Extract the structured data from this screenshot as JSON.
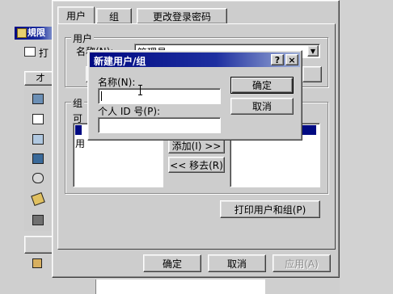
{
  "background_window": {
    "title_fragment": "規限",
    "toolbar_label": "打",
    "column_header": "才"
  },
  "main_dialog": {
    "tabs": [
      {
        "label": "用户",
        "active": true
      },
      {
        "label": "组",
        "active": false
      },
      {
        "label": "更改登录密码",
        "active": false
      }
    ],
    "user_group_title": "用户",
    "name_label": "名称(N):",
    "name_value": "管理員",
    "group_title_fragment": "组",
    "available_label": "可",
    "list_items": [
      "用"
    ],
    "add_button": "添加(I) >>",
    "remove_button": "<< 移去(R)",
    "print_button": "打印用户和组(P)",
    "ok_button": "确定",
    "cancel_button": "取消",
    "apply_button": "应用(A)"
  },
  "new_dialog": {
    "title": "新建用户/组",
    "help_label": "?",
    "close_label": "×",
    "name_label": "名称(N):",
    "name_value": "",
    "id_label": "个人 ID 号(P):",
    "id_value": "",
    "ok_button": "确定",
    "cancel_button": "取消"
  },
  "colors": {
    "title_bar": "#000a82",
    "selection": "#000a82",
    "face": "#cdcdcd",
    "desktop": "#cfcfcf"
  }
}
